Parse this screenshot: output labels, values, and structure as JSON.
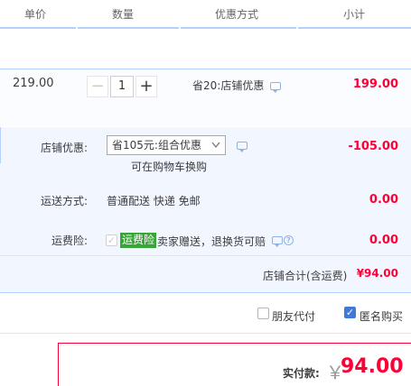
{
  "header": {
    "col_unit_price": "单价",
    "col_quantity": "数量",
    "col_discount": "优惠方式",
    "col_subtotal": "小计"
  },
  "item": {
    "unit_price": "219.00",
    "quantity": "1",
    "minus_symbol": "−",
    "plus_symbol": "+",
    "promotion": "省20:店铺优惠",
    "subtotal": "199.00"
  },
  "shop_discount": {
    "label": "店铺优惠:",
    "selected_option": "省105元:组合优惠",
    "hint": "可在购物车换购",
    "amount": "-105.00"
  },
  "shipping": {
    "label": "运送方式:",
    "method": "普通配送 快递 免邮",
    "amount": "0.00"
  },
  "insurance": {
    "label": "运费险:",
    "badge": "运费险",
    "description": "卖家赠送，退换货可赔",
    "question_mark": "?",
    "amount": "0.00",
    "checked": true
  },
  "shop_total": {
    "label": "店铺合计(含运费)",
    "amount": "¥94.00"
  },
  "options": {
    "friend_pay_label": "朋友代付",
    "friend_pay_checked": false,
    "anonymous_label": "匿名购买",
    "anonymous_checked": true,
    "checkmark": "✓"
  },
  "payment": {
    "label": "实付款:",
    "currency": "￥",
    "amount": "94.00"
  },
  "icons": {
    "chat": "chat-bubble-icon",
    "help": "question-circle-icon",
    "dropdown": "chevron-down-icon"
  },
  "colors": {
    "accent_red": "#ff0036",
    "border_blue": "#b2d1ff",
    "panel_bg": "#f2f7ff",
    "badge_green": "#38a538",
    "checkbox_blue": "#3e7ad6"
  }
}
